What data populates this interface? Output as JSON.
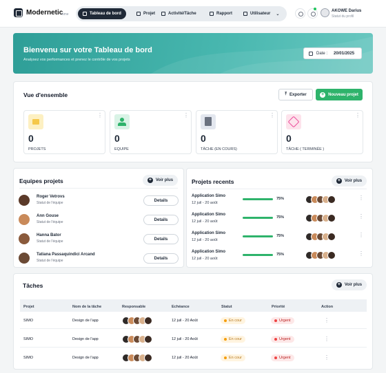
{
  "header": {
    "brand": "Modernetic",
    "brand_sub": "sime",
    "nav": [
      {
        "label": "Tableau de bord"
      },
      {
        "label": "Projet"
      },
      {
        "label": "Activité/Tâche"
      },
      {
        "label": "Rapport"
      },
      {
        "label": "Utilisateur"
      }
    ],
    "user": {
      "name": "AKOWE Darius",
      "status": "Statut du profil"
    }
  },
  "banner": {
    "title": "Bienvenu sur votre Tableau de bord",
    "subtitle": "Analysez vos performances et prenez le contrôle de vos projets",
    "date_label": "Date :",
    "date_value": "20/01/2025"
  },
  "overview": {
    "title": "Vue d'ensemble",
    "export_label": "Exporter",
    "new_project_label": "Nouveau projet",
    "stats": [
      {
        "value": "0",
        "label": "PROJETS",
        "color": "#fdf0c2",
        "icon": "folder-icon"
      },
      {
        "value": "0",
        "label": "EQUIPE",
        "color": "#d9f3e6",
        "icon": "team-icon"
      },
      {
        "value": "0",
        "label": "TÂCHE (EN COURS)",
        "color": "#e3e7ef",
        "icon": "clipboard-icon"
      },
      {
        "value": "0",
        "label": "TÂCHE ( TERMINÉE )",
        "color": "#fde3ec",
        "icon": "check-task-icon"
      }
    ]
  },
  "teams": {
    "title": "Equipes projets",
    "see_more": "Voir plus",
    "members": [
      {
        "name": "Roger Vetrovs",
        "role": "Statut de l'équipe",
        "action": "Details"
      },
      {
        "name": "Ann Gouse",
        "role": "Statut de l'équipe",
        "action": "Details"
      },
      {
        "name": "Hanna Bator",
        "role": "Statut de l'équipe",
        "action": "Details"
      },
      {
        "name": "Tatiana Passaquindici Arcand",
        "role": "Statut de l'équipe",
        "action": "Details"
      }
    ]
  },
  "recent": {
    "title": "Projets recents",
    "see_more": "Voir plus",
    "projects": [
      {
        "name": "Application Simo",
        "dates": "12 juil - 20 août",
        "progress": 75,
        "progress_label": "75%"
      },
      {
        "name": "Application Simo",
        "dates": "12 juil - 20 août",
        "progress": 75,
        "progress_label": "75%"
      },
      {
        "name": "Application Simo",
        "dates": "12 juil - 20 août",
        "progress": 75,
        "progress_label": "75%"
      },
      {
        "name": "Application Simo",
        "dates": "12 juil - 20 août",
        "progress": 75,
        "progress_label": "75%"
      }
    ]
  },
  "tasks": {
    "title": "Tâches",
    "see_more": "Voir plus",
    "columns": [
      "Projet",
      "Nom de la tâche",
      "Responsable",
      "Echéance",
      "Statut",
      "Priorité",
      "Action"
    ],
    "rows": [
      {
        "project": "SIMO",
        "task": "Design de l'app",
        "due": "12 juil - 20 Août",
        "status": "En cour",
        "priority": "Urgent"
      },
      {
        "project": "SIMO",
        "task": "Design de l'app",
        "due": "12 juil - 20 Août",
        "status": "En cour",
        "priority": "Urgent"
      },
      {
        "project": "SIMO",
        "task": "Design de l'app",
        "due": "12 juil - 20 Août",
        "status": "En cour",
        "priority": "Urgent"
      }
    ]
  },
  "colors": {
    "accent": "#2eb36b",
    "banner": "#3aaea6",
    "dark": "#1f2937",
    "status_orange": "#f59e0b",
    "priority_red": "#ef4444"
  }
}
